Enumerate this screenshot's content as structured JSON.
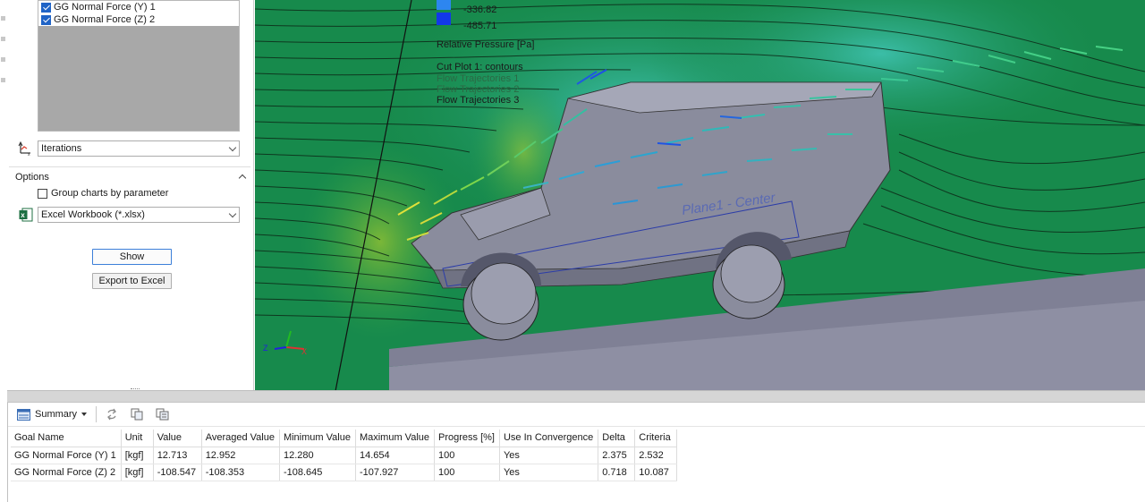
{
  "goals_panel": {
    "items": [
      {
        "label": "GG Normal Force (Y) 1",
        "checked": true
      },
      {
        "label": "GG Normal Force (Z) 2",
        "checked": true
      }
    ]
  },
  "x_axis_select": {
    "value": "Iterations"
  },
  "options": {
    "title": "Options",
    "group_label": "Group charts by parameter",
    "group_checked": false
  },
  "format_select": {
    "value": "Excel Workbook (*.xlsx)"
  },
  "buttons": {
    "show": "Show",
    "export": "Export to Excel"
  },
  "viewport": {
    "legend": {
      "values": [
        "-336.82",
        "-485.71"
      ],
      "colors": [
        "#2d86f0",
        "#1238e8"
      ],
      "title": "Relative Pressure [Pa]",
      "features": [
        "Cut Plot 1: contours",
        "Flow Trajectories 1",
        "Flow Trajectories 2",
        "Flow Trajectories 3"
      ]
    },
    "plane_label": "Plane1 - Center",
    "triad": {
      "z": "Z",
      "x": "X"
    },
    "colors": {
      "fluid": "#178a4c",
      "fluid_light": "#2fb49a",
      "ground": "#8e8fa3",
      "body": "#8a8c9d"
    }
  },
  "bottom": {
    "toolbar": {
      "summary_label": "Summary"
    },
    "table": {
      "headers": [
        "Goal Name",
        "Unit",
        "Value",
        "Averaged Value",
        "Minimum Value",
        "Maximum Value",
        "Progress [%]",
        "Use In Convergence",
        "Delta",
        "Criteria"
      ],
      "rows": [
        [
          "GG Normal Force (Y) 1",
          "[kgf]",
          "12.713",
          "12.952",
          "12.280",
          "14.654",
          "100",
          "Yes",
          "2.375",
          "2.532"
        ],
        [
          "GG Normal Force (Z) 2",
          "[kgf]",
          "-108.547",
          "-108.353",
          "-108.645",
          "-107.927",
          "100",
          "Yes",
          "0.718",
          "10.087"
        ]
      ]
    }
  }
}
